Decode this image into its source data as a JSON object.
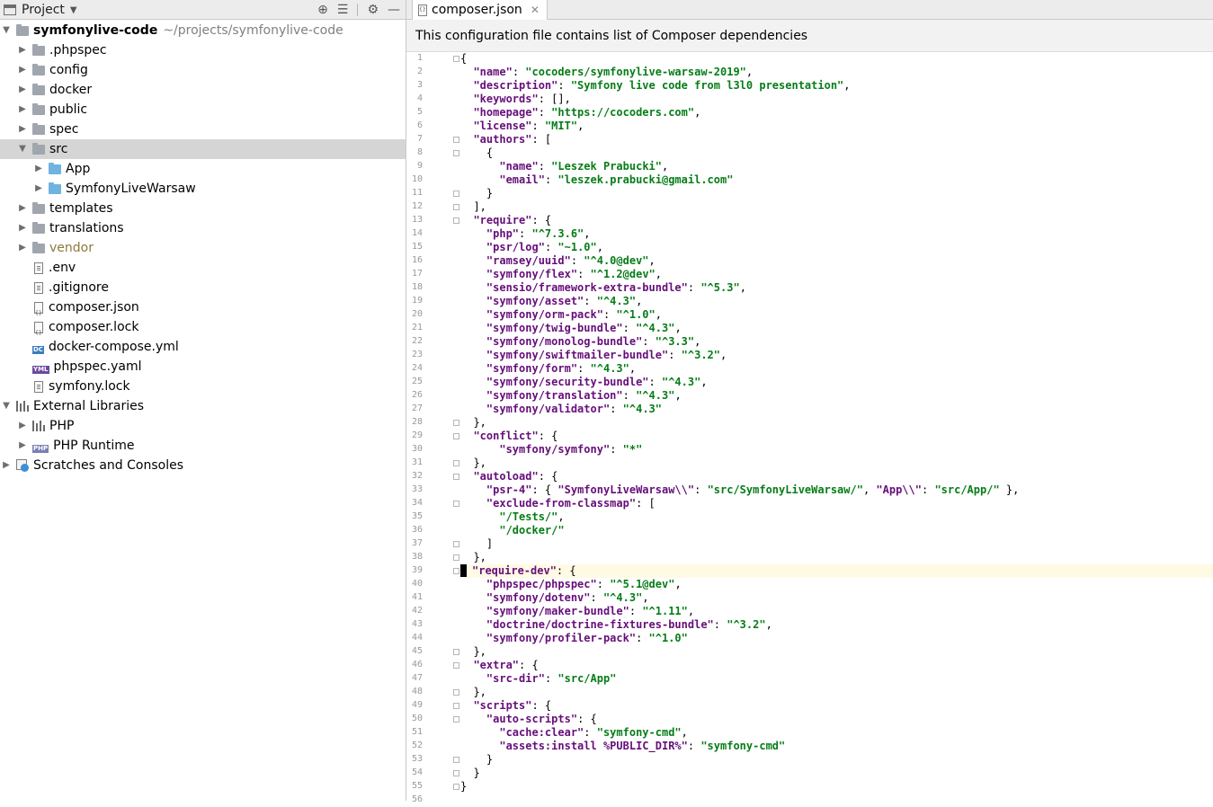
{
  "project_panel": {
    "title": "Project",
    "root": {
      "name": "symfonylive-code",
      "path": "~/projects/symfonylive-code"
    },
    "items": [
      {
        "label": ".phpspec",
        "kind": "folder",
        "depth": 1,
        "arrow": "right"
      },
      {
        "label": "config",
        "kind": "folder",
        "depth": 1,
        "arrow": "right"
      },
      {
        "label": "docker",
        "kind": "folder",
        "depth": 1,
        "arrow": "right"
      },
      {
        "label": "public",
        "kind": "folder",
        "depth": 1,
        "arrow": "right"
      },
      {
        "label": "spec",
        "kind": "folder",
        "depth": 1,
        "arrow": "right"
      },
      {
        "label": "src",
        "kind": "folder",
        "depth": 1,
        "arrow": "down",
        "selected": true
      },
      {
        "label": "App",
        "kind": "folder-blue",
        "depth": 2,
        "arrow": "right"
      },
      {
        "label": "SymfonyLiveWarsaw",
        "kind": "folder-blue",
        "depth": 2,
        "arrow": "right"
      },
      {
        "label": "templates",
        "kind": "folder",
        "depth": 1,
        "arrow": "right"
      },
      {
        "label": "translations",
        "kind": "folder",
        "depth": 1,
        "arrow": "right"
      },
      {
        "label": "vendor",
        "kind": "folder",
        "depth": 1,
        "arrow": "right",
        "vendor": true
      },
      {
        "label": ".env",
        "kind": "file",
        "depth": 1
      },
      {
        "label": ".gitignore",
        "kind": "file",
        "depth": 1
      },
      {
        "label": "composer.json",
        "kind": "file-json",
        "depth": 1
      },
      {
        "label": "composer.lock",
        "kind": "file-json",
        "depth": 1
      },
      {
        "label": "docker-compose.yml",
        "kind": "file-dc",
        "depth": 1
      },
      {
        "label": "phpspec.yaml",
        "kind": "file-yml",
        "depth": 1
      },
      {
        "label": "symfony.lock",
        "kind": "file",
        "depth": 1
      },
      {
        "label": "External Libraries",
        "kind": "library",
        "depth": 0,
        "arrow": "down"
      },
      {
        "label": "PHP",
        "kind": "library",
        "depth": 1,
        "arrow": "right"
      },
      {
        "label": "PHP Runtime",
        "kind": "php",
        "depth": 1,
        "arrow": "right"
      },
      {
        "label": "Scratches and Consoles",
        "kind": "scratch",
        "depth": 0,
        "arrow": "right"
      }
    ]
  },
  "editor": {
    "tab_label": "composer.json",
    "banner": "This configuration file contains list of Composer dependencies",
    "current_line": 39,
    "lines": [
      "{",
      "  \"name\": \"cocoders/symfonylive-warsaw-2019\",",
      "  \"description\": \"Symfony live code from l3l0 presentation\",",
      "  \"keywords\": [],",
      "  \"homepage\": \"https://cocoders.com\",",
      "  \"license\": \"MIT\",",
      "  \"authors\": [",
      "    {",
      "      \"name\": \"Leszek Prabucki\",",
      "      \"email\": \"leszek.prabucki@gmail.com\"",
      "    }",
      "  ],",
      "  \"require\": {",
      "    \"php\": \"^7.3.6\",",
      "    \"psr/log\": \"~1.0\",",
      "    \"ramsey/uuid\": \"^4.0@dev\",",
      "    \"symfony/flex\": \"^1.2@dev\",",
      "    \"sensio/framework-extra-bundle\": \"^5.3\",",
      "    \"symfony/asset\": \"^4.3\",",
      "    \"symfony/orm-pack\": \"^1.0\",",
      "    \"symfony/twig-bundle\": \"^4.3\",",
      "    \"symfony/monolog-bundle\": \"^3.3\",",
      "    \"symfony/swiftmailer-bundle\": \"^3.2\",",
      "    \"symfony/form\": \"^4.3\",",
      "    \"symfony/security-bundle\": \"^4.3\",",
      "    \"symfony/translation\": \"^4.3\",",
      "    \"symfony/validator\": \"^4.3\"",
      "  },",
      "  \"conflict\": {",
      "      \"symfony/symfony\": \"*\"",
      "  },",
      "  \"autoload\": {",
      "    \"psr-4\": { \"SymfonyLiveWarsaw\\\\\": \"src/SymfonyLiveWarsaw/\", \"App\\\\\": \"src/App/\" },",
      "    \"exclude-from-classmap\": [",
      "      \"/Tests/\",",
      "      \"/docker/\"",
      "    ]",
      "  },",
      "  \"require-dev\": {",
      "    \"phpspec/phpspec\": \"^5.1@dev\",",
      "    \"symfony/dotenv\": \"^4.3\",",
      "    \"symfony/maker-bundle\": \"^1.11\",",
      "    \"doctrine/doctrine-fixtures-bundle\": \"^3.2\",",
      "    \"symfony/profiler-pack\": \"^1.0\"",
      "  },",
      "  \"extra\": {",
      "    \"src-dir\": \"src/App\"",
      "  },",
      "  \"scripts\": {",
      "    \"auto-scripts\": {",
      "      \"cache:clear\": \"symfony-cmd\",",
      "      \"assets:install %PUBLIC_DIR%\": \"symfony-cmd\"",
      "    }",
      "  }",
      "}",
      ""
    ],
    "fold_lines": [
      1,
      7,
      8,
      11,
      12,
      13,
      28,
      29,
      31,
      32,
      34,
      37,
      38,
      39,
      45,
      46,
      48,
      49,
      50,
      53,
      54,
      55
    ]
  }
}
